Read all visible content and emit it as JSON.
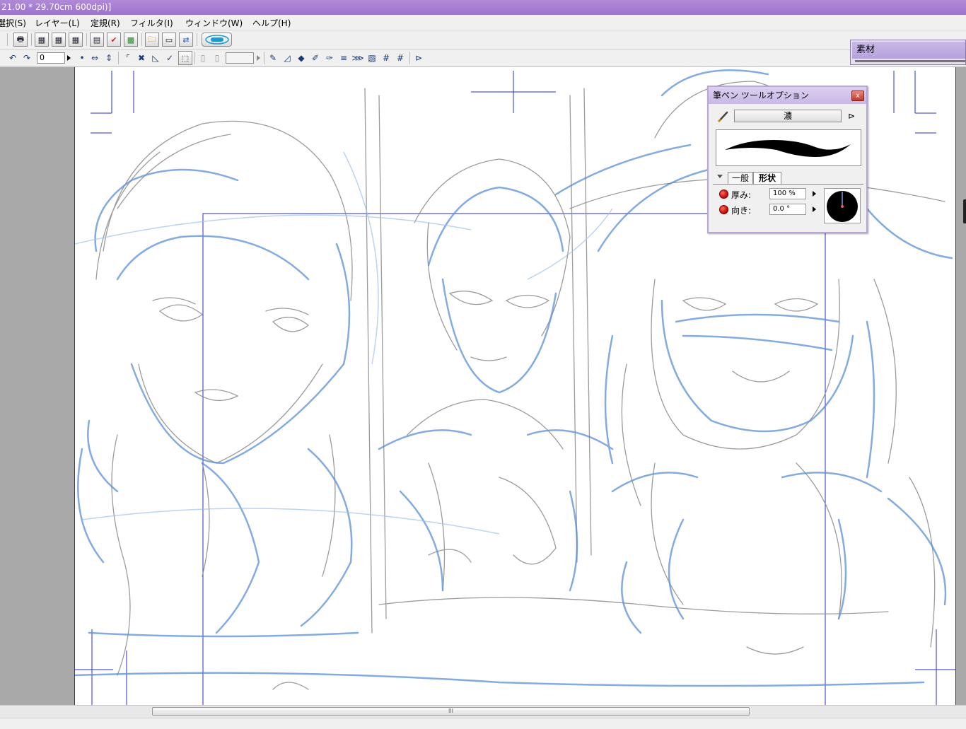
{
  "window": {
    "title": "21.00 * 29.70cm 600dpi)]"
  },
  "menu": {
    "items": [
      "選択(S)",
      "レイヤー(L)",
      "定規(R)",
      "フィルタ(I)",
      "ウィンドウ(W)",
      "ヘルプ(H)"
    ]
  },
  "toolbar": {
    "rotation_value": "0",
    "extra_value": ""
  },
  "materials_panel": {
    "title": "素材"
  },
  "tool_options": {
    "title": "筆ペン ツールオプション",
    "close_label": "x",
    "preset_name": "濃",
    "tabs": [
      "一般",
      "形状"
    ],
    "active_tab": "形状",
    "properties": [
      {
        "label": "厚み:",
        "value": "100 %"
      },
      {
        "label": "向き:",
        "value": "0.0 °"
      }
    ]
  },
  "scrollbar": {
    "thumb_grip": "III"
  },
  "colors": {
    "titlebar": "#9c74cc",
    "guide_blue": "#2a2ad0",
    "sketch_blue": "#5b8fd6",
    "sketch_gray": "#8a8a8a",
    "workspace": "#a9a9a9"
  }
}
